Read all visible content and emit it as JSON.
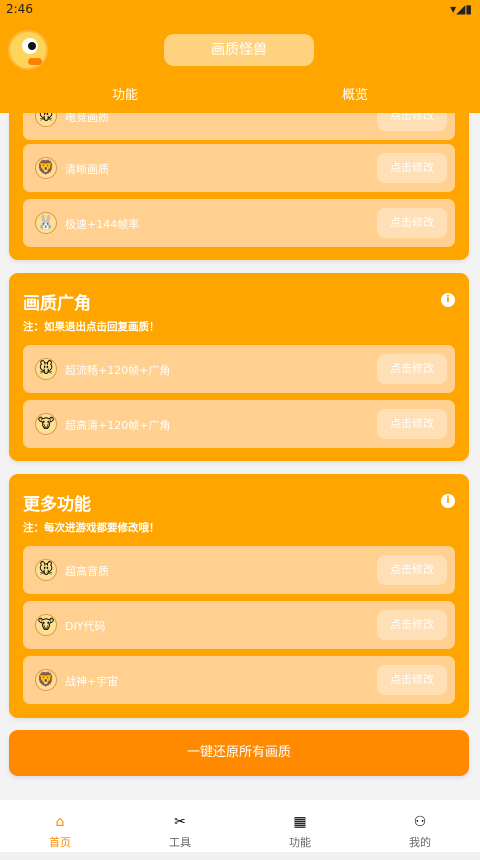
{
  "status": {
    "time": "2:46",
    "icons": "▾◢▮"
  },
  "header": {
    "title": "画质怪兽",
    "tabs": [
      {
        "label": "功能"
      },
      {
        "label": "概览"
      }
    ]
  },
  "sections": [
    {
      "rows": [
        {
          "label": "电竞画质",
          "button": "点击修改",
          "animal": "🐭"
        },
        {
          "label": "清晰画质",
          "button": "点击修改",
          "animal": "🦁"
        },
        {
          "label": "极速+144帧率",
          "button": "点击修改",
          "animal": "🐰"
        }
      ]
    },
    {
      "title": "画质广角",
      "note": "注：如果退出点击回复画质！",
      "rows": [
        {
          "label": "超流畅+120帧+广角",
          "button": "点击修改",
          "animal": "🐭"
        },
        {
          "label": "超高清+120帧+广角",
          "button": "点击修改",
          "animal": "🐮"
        }
      ]
    },
    {
      "title": "更多功能",
      "note": "注：每次进游戏都要修改哦！",
      "rows": [
        {
          "label": "超高音质",
          "button": "点击修改",
          "animal": "🐭"
        },
        {
          "label": "DIY代码",
          "button": "点击修改",
          "animal": "🐮"
        },
        {
          "label": "战神+宇宙",
          "button": "点击修改",
          "animal": "🦁"
        }
      ]
    }
  ],
  "reset_label": "一键还原所有画质",
  "bottomnav": [
    {
      "label": "首页",
      "icon": "home-icon",
      "glyph": "⌂"
    },
    {
      "label": "工具",
      "icon": "tools-icon",
      "glyph": "✂"
    },
    {
      "label": "功能",
      "icon": "grid-icon",
      "glyph": "▦"
    },
    {
      "label": "我的",
      "icon": "user-icon",
      "glyph": "⚇"
    }
  ]
}
